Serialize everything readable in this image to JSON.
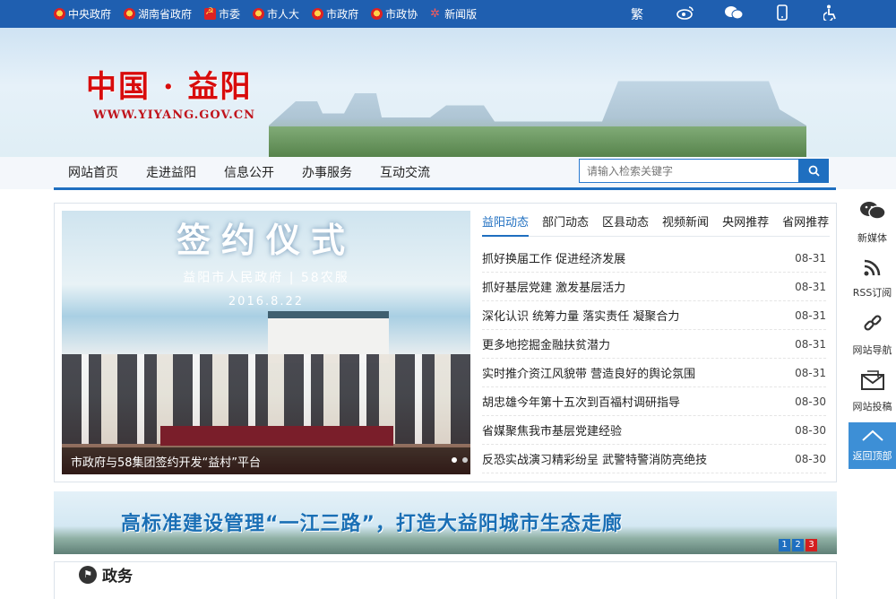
{
  "top_links": [
    "中央政府",
    "湖南省政府",
    "市委",
    "市人大",
    "市政府",
    "市政协",
    "新闻版"
  ],
  "top_icons": {
    "traditional": "繁",
    "weibo": "weibo-icon",
    "wechat": "wechat-icon",
    "mobile": "mobile-icon",
    "accessibility": "accessibility-icon"
  },
  "site": {
    "title": "中国 · 益阳",
    "url": "WWW.YIYANG.GOV.CN"
  },
  "nav": [
    "网站首页",
    "走进益阳",
    "信息公开",
    "办事服务",
    "互动交流"
  ],
  "search": {
    "placeholder": "请输入检索关键字"
  },
  "slide": {
    "title": "签约仪式",
    "subtitle": "益阳市人民政府 | 58农服",
    "date": "2016.8.22",
    "caption": "市政府与58集团签约开发“益村”平台",
    "dot_count": 6,
    "active_dot": 0
  },
  "tabs": [
    "益阳动态",
    "部门动态",
    "区县动态",
    "视频新闻",
    "央网推荐",
    "省网推荐"
  ],
  "news": [
    {
      "title": "抓好换届工作 促进经济发展",
      "date": "08-31"
    },
    {
      "title": "抓好基层党建 激发基层活力",
      "date": "08-31"
    },
    {
      "title": "深化认识 统筹力量 落实责任 凝聚合力",
      "date": "08-31"
    },
    {
      "title": "更多地挖掘金融扶贫潜力",
      "date": "08-31"
    },
    {
      "title": "实时推介资江风貌带 营造良好的舆论氛围",
      "date": "08-31"
    },
    {
      "title": "胡忠雄今年第十五次到百福村调研指导",
      "date": "08-30"
    },
    {
      "title": "省媒聚焦我市基层党建经验",
      "date": "08-30"
    },
    {
      "title": "反恐实战演习精彩纷呈 武警特警消防亮绝技",
      "date": "08-30"
    }
  ],
  "float": [
    "新媒体",
    "RSS订阅",
    "网站导航",
    "网站投稿"
  ],
  "back_to_top": "返回顶部",
  "ad": {
    "text": "高标准建设管理“一江三路”，打造大益阳城市生态走廊",
    "pages": [
      "1",
      "2",
      "3"
    ],
    "active_page": 2
  },
  "section": {
    "title": "政务"
  },
  "colors": {
    "primary": "#1f6fc0",
    "title_red": "#d80c0c"
  }
}
